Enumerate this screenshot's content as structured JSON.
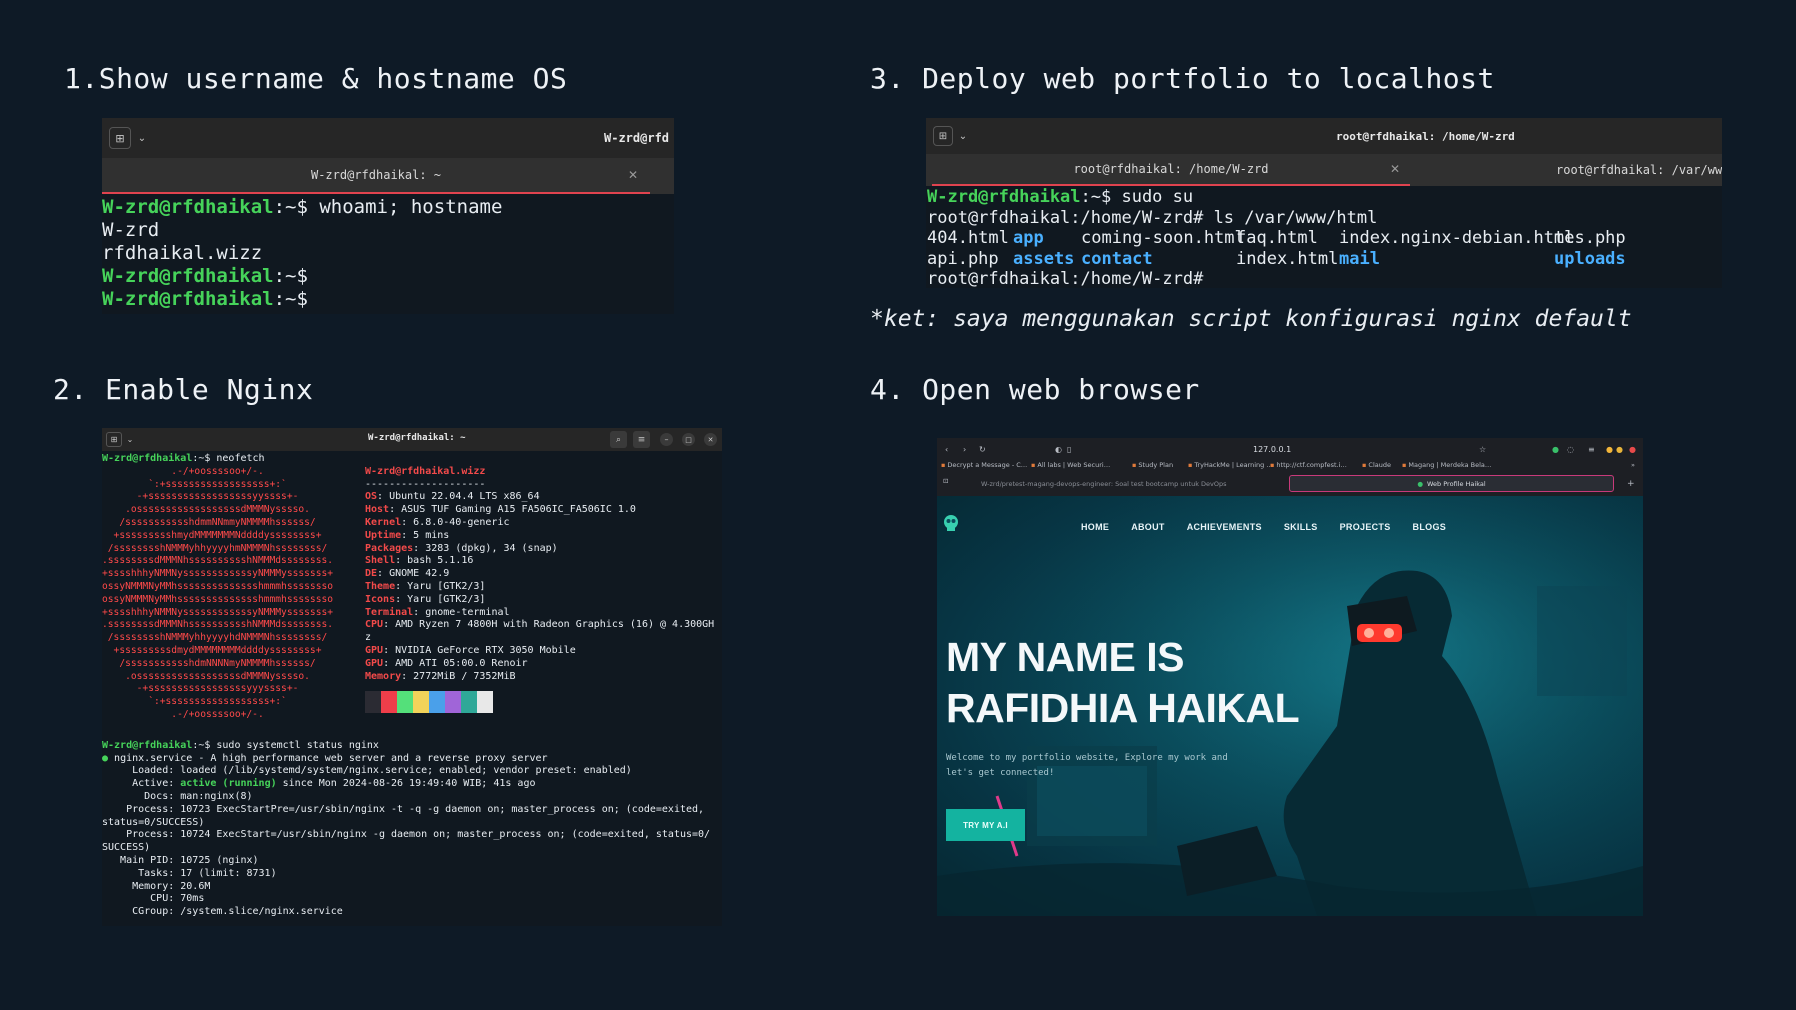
{
  "headings": {
    "h1": "1.Show username & hostname OS",
    "h2": "2. Enable Nginx",
    "h3": "3. Deploy web portfolio to localhost",
    "h4": "4. Open web browser"
  },
  "note": "*ket: saya menggunakan script konfigurasi nginx default",
  "term1": {
    "title": "W-zrd@rfd",
    "tab": "W-zrd@rfdhaikal: ~",
    "prompt_user": "W-zrd@rfdhaikal",
    "prompt_path": ":~$ ",
    "command": "whoami; hostname",
    "out1": "W-zrd",
    "out2": "rfdhaikal.wizz",
    "empty_prompt": ":~$"
  },
  "term2": {
    "title": "W-zrd@rfdhaikal: ~",
    "prompt_user": "W-zrd@rfdhaikal",
    "cmd1": ":~$ neofetch",
    "header": "W-zrd@rfdhaikal.wizz",
    "sep": "--------------------",
    "info": [
      {
        "k": "OS",
        "v": ": Ubuntu 22.04.4 LTS x86_64"
      },
      {
        "k": "Host",
        "v": ": ASUS TUF Gaming A15 FA506IC_FA506IC 1.0"
      },
      {
        "k": "Kernel",
        "v": ": 6.8.0-40-generic"
      },
      {
        "k": "Uptime",
        "v": ": 5 mins"
      },
      {
        "k": "Packages",
        "v": ": 3283 (dpkg), 34 (snap)"
      },
      {
        "k": "Shell",
        "v": ": bash 5.1.16"
      },
      {
        "k": "DE",
        "v": ": GNOME 42.9"
      },
      {
        "k": "Theme",
        "v": ": Yaru [GTK2/3]"
      },
      {
        "k": "Icons",
        "v": ": Yaru [GTK2/3]"
      },
      {
        "k": "Terminal",
        "v": ": gnome-terminal"
      },
      {
        "k": "CPU",
        "v": ": AMD Ryzen 7 4800H with Radeon Graphics (16) @ 4.300GH"
      },
      {
        "k": "",
        "v": "z"
      },
      {
        "k": "GPU",
        "v": ": NVIDIA GeForce RTX 3050 Mobile"
      },
      {
        "k": "GPU",
        "v": ": AMD ATI 05:00.0 Renoir"
      },
      {
        "k": "Memory",
        "v": ": 2772MiB / 7352MiB"
      }
    ],
    "ascii": [
      "            .-/+oossssoo+/-.",
      "        `:+ssssssssssssssssss+:`",
      "      -+ssssssssssssssssssyyssss+-",
      "    .ossssssssssssssssssdMMMNysssso.",
      "   /ssssssssssshdmmNNmmyNMMMMhssssss/",
      "  +ssssssssshmydMMMMMMMNddddyssssssss+",
      " /sssssssshNMMMyhhyyyyhmNMMMNhssssssss/",
      ".ssssssssdMMMNhsssssssssshNMMMdssssssss.",
      "+sssshhhyNMMNyssssssssssssyNMMMysssssss+",
      "ossyNMMMNyMMhsssssssssssssshmmmhssssssso",
      "ossyNMMMNyMMhsssssssssssssshmmmhssssssso",
      "+sssshhhyNMMNyssssssssssssyNMMMysssssss+",
      ".ssssssssdMMMNhsssssssssshNMMMdssssssss.",
      " /sssssssshNMMMyhhyyyyhdNMMMNhssssssss/",
      "  +sssssssssdmydMMMMMMMMddddyssssssss+",
      "   /ssssssssssshdmNNNNmyNMMMMhssssss/",
      "    .ossssssssssssssssssdMMMNysssso.",
      "      -+sssssssssssssssssyyyssss+-",
      "        `:+ssssssssssssssssss+:`",
      "            .-/+oossssoo+/-."
    ],
    "palette": [
      "#2b2b33",
      "#ef3e4a",
      "#54e07a",
      "#f2d35a",
      "#4aa0ea",
      "#a065d8",
      "#2fa898",
      "#e8e8e8"
    ],
    "cmd2": ":~$ sudo systemctl status nginx",
    "status": [
      "● nginx.service - A high performance web server and a reverse proxy server",
      "     Loaded: loaded (/lib/systemd/system/nginx.service; enabled; vendor preset: enabled)",
      "     Active: active (running) since Mon 2024-08-26 19:49:40 WIB; 41s ago",
      "       Docs: man:nginx(8)",
      "    Process: 10723 ExecStartPre=/usr/sbin/nginx -t -q -g daemon on; master_process on; (code=exited,",
      "status=0/SUCCESS)",
      "    Process: 10724 ExecStart=/usr/sbin/nginx -g daemon on; master_process on; (code=exited, status=0/",
      "SUCCESS)",
      "   Main PID: 10725 (nginx)",
      "      Tasks: 17 (limit: 8731)",
      "     Memory: 20.6M",
      "        CPU: 70ms",
      "     CGroup: /system.slice/nginx.service"
    ],
    "active_label": "active (running)"
  },
  "term3": {
    "title": "root@rfdhaikal: /home/W-zrd",
    "tab1": "root@rfdhaikal: /home/W-zrd",
    "tab2": "root@rfdhaikal: /var/www/",
    "prompt_user": "W-zrd@rfdhaikal",
    "line1_rest": ":~$ sudo su",
    "line2": "root@rfdhaikal:/home/W-zrd# ls /var/www/html",
    "files_row1": [
      {
        "name": "404.html",
        "dir": false
      },
      {
        "name": "app",
        "dir": true
      },
      {
        "name": "coming-soon.html",
        "dir": false
      },
      {
        "name": "faq.html",
        "dir": false
      },
      {
        "name": "index.nginx-debian.html",
        "dir": false
      },
      {
        "name": "tes.php",
        "dir": false
      }
    ],
    "files_row2": [
      {
        "name": "api.php",
        "dir": false
      },
      {
        "name": "assets",
        "dir": true
      },
      {
        "name": "contact",
        "dir": true
      },
      {
        "name": "index.html",
        "dir": false
      },
      {
        "name": "mail",
        "dir": true
      },
      {
        "name": "uploads",
        "dir": true
      }
    ],
    "line_end": "root@rfdhaikal:/home/W-zrd#"
  },
  "browser": {
    "url": "127.0.0.1",
    "bookmarks": [
      "Decrypt a Message - C…",
      "All labs | Web Securi…",
      "Study Plan",
      "TryHackMe | Learning …",
      "http://ctf.compfest.i…",
      "Claude",
      "Magang | Merdeka Bela…"
    ],
    "tab_left": "W-zrd/pretest-magang-devops-engineer: Soal test bootcamp untuk DevOps",
    "tab_right": "Web Profile Haikal",
    "nav": [
      "HOME",
      "ABOUT",
      "ACHIEVEMENTS",
      "SKILLS",
      "PROJECTS",
      "BLOGS"
    ],
    "hero_line1": "MY NAME IS",
    "hero_line2": "RAFIDHIA HAIKAL",
    "subtitle": "Welcome to my portfolio website, Explore my work and let's get connected!",
    "cta": "TRY MY A.I"
  }
}
